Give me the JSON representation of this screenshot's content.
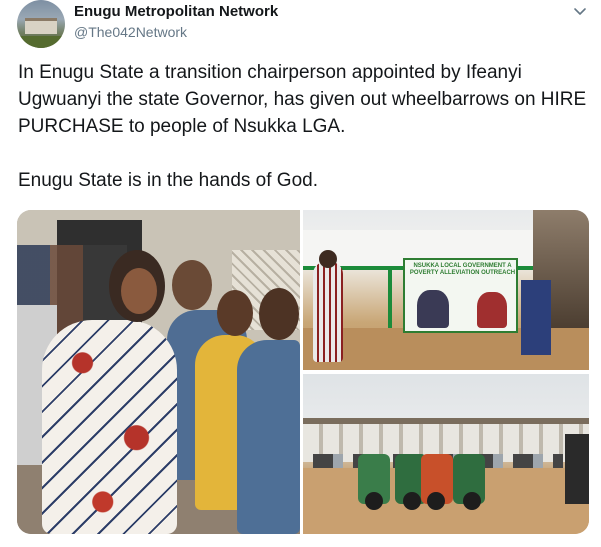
{
  "tweet": {
    "display_name": "Enugu Metropolitan Network",
    "handle": "@The042Network",
    "text_p1": "In Enugu State a transition chairperson appointed by Ifeanyi Ugwuanyi the state Governor, has given out wheelbarrows on HIRE PURCHASE to people of Nsukka LGA.",
    "text_p2": "Enugu State is in the hands of God.",
    "banner_title": "NSUKKA LOCAL GOVERNMENT A POVERTY ALLEVIATION OUTREACH"
  },
  "icons": {
    "more": "chevron-down-icon",
    "avatar": "avatar-image"
  },
  "colors": {
    "text": "#14171a",
    "secondary": "#657786"
  }
}
